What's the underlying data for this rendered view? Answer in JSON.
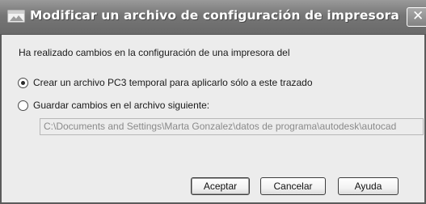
{
  "window": {
    "title": "Modificar un archivo de configuración de impresora",
    "close_glyph": "✕"
  },
  "dialog": {
    "message": "Ha realizado cambios en la configuración de una impresora del",
    "options": [
      {
        "label": "Crear un archivo PC3 temporal para aplicarlo sólo a este trazado",
        "selected": true
      },
      {
        "label": "Guardar cambios en el archivo siguiente:",
        "selected": false
      }
    ],
    "file_path": "C:\\Documents and Settings\\Marta Gonzalez\\datos de programa\\autodesk\\autocad"
  },
  "buttons": {
    "accept": "Aceptar",
    "cancel": "Cancelar",
    "help": "Ayuda"
  },
  "icons": {
    "title": "printer-window-icon",
    "close": "close-icon"
  }
}
